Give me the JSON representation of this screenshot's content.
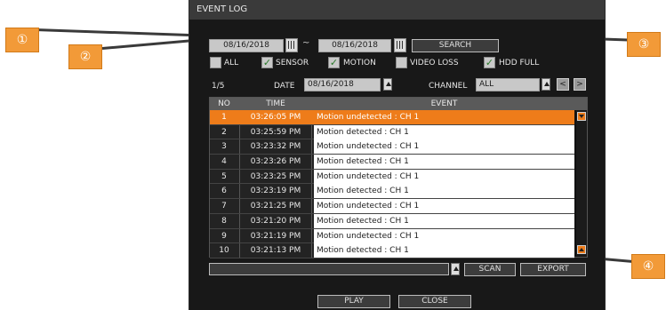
{
  "window": {
    "title": "EVENT LOG"
  },
  "search": {
    "start_date": "08/16/2018",
    "separator": "~",
    "end_date": "08/16/2018",
    "search_label": "SEARCH"
  },
  "filters": [
    {
      "label": "ALL",
      "checked": false
    },
    {
      "label": "SENSOR",
      "checked": true
    },
    {
      "label": "MOTION",
      "checked": true
    },
    {
      "label": "VIDEO LOSS",
      "checked": false
    },
    {
      "label": "HDD FULL",
      "checked": true
    }
  ],
  "check_glyph": "✓",
  "info": {
    "page": "1/5",
    "date_label": "DATE",
    "date_value": "08/16/2018",
    "channel_label": "CHANNEL",
    "channel_value": "ALL",
    "prev_glyph": "<",
    "next_glyph": ">"
  },
  "table": {
    "headers": {
      "no": "NO",
      "time": "TIME",
      "event": "EVENT"
    },
    "selected_index": 0,
    "rows": [
      {
        "no": "1",
        "time": "03:26:05 PM",
        "event": "Motion undetected : CH 1"
      },
      {
        "no": "2",
        "time": "03:25:59 PM",
        "event": "Motion detected : CH 1"
      },
      {
        "no": "3",
        "time": "03:23:32 PM",
        "event": "Motion undetected : CH 1"
      },
      {
        "no": "4",
        "time": "03:23:26 PM",
        "event": "Motion detected : CH 1"
      },
      {
        "no": "5",
        "time": "03:23:25 PM",
        "event": "Motion undetected : CH 1"
      },
      {
        "no": "6",
        "time": "03:23:19 PM",
        "event": "Motion detected : CH 1"
      },
      {
        "no": "7",
        "time": "03:21:25 PM",
        "event": "Motion undetected : CH 1"
      },
      {
        "no": "8",
        "time": "03:21:20 PM",
        "event": "Motion detected : CH 1"
      },
      {
        "no": "9",
        "time": "03:21:19 PM",
        "event": "Motion undetected : CH 1"
      },
      {
        "no": "10",
        "time": "03:21:13 PM",
        "event": "Motion detected : CH 1"
      }
    ]
  },
  "actions": {
    "scan": "SCAN",
    "export": "EXPORT",
    "play": "PLAY",
    "close": "CLOSE"
  },
  "callouts": [
    "①",
    "②",
    "③",
    "④"
  ],
  "colors": {
    "accent": "#ee7c1a",
    "callout": "#f29a38",
    "window_bg": "#181818"
  }
}
